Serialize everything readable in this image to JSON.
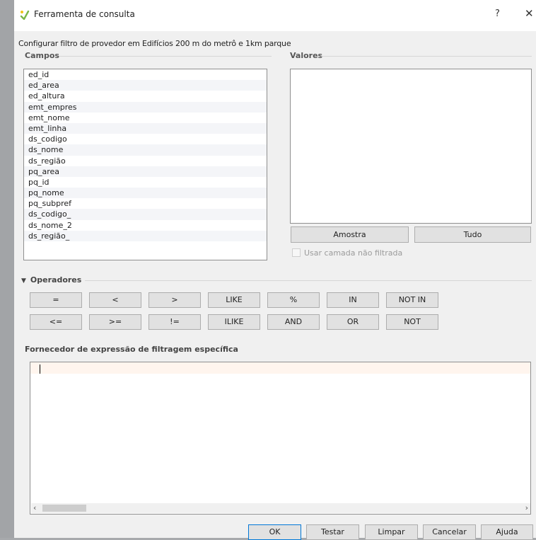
{
  "window": {
    "title": "Ferramenta de consulta",
    "help_label": "?",
    "close_label": "✕"
  },
  "description": "Configurar filtro de provedor em Edifícios 200 m do metrô e 1km parque",
  "fields": {
    "label": "Campos",
    "items": [
      "ed_id",
      "ed_area",
      "ed_altura",
      "emt_empres",
      "emt_nome",
      "emt_linha",
      "ds_codigo",
      "ds_nome",
      "ds_região",
      "pq_area",
      "pq_id",
      "pq_nome",
      "pq_subpref",
      "ds_codigo_",
      "ds_nome_2",
      "ds_região_"
    ]
  },
  "values": {
    "label": "Valores",
    "sample_label": "Amostra",
    "all_label": "Tudo",
    "unfiltered_label": "Usar camada não filtrada"
  },
  "operators": {
    "label": "Operadores",
    "row1": [
      "=",
      "<",
      ">",
      "LIKE",
      "%",
      "IN",
      "NOT IN"
    ],
    "row2": [
      "<=",
      ">=",
      "!=",
      "ILIKE",
      "AND",
      "OR",
      "NOT"
    ]
  },
  "expression": {
    "label": "Fornecedor de expressão de filtragem específica",
    "value": ""
  },
  "buttons": {
    "ok": "OK",
    "test": "Testar",
    "clear": "Limpar",
    "cancel": "Cancelar",
    "help": "Ajuda"
  },
  "colors": {
    "ok_border": "#0078d7",
    "current_line": "#fff5ee"
  },
  "icons": {
    "title": "qgis-filter-icon",
    "collapse": "triangle-down-icon"
  }
}
